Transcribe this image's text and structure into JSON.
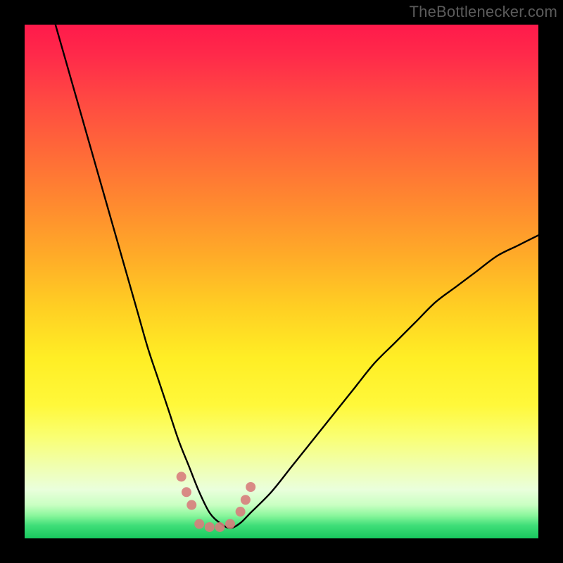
{
  "watermark": "TheBottlenecker.com",
  "colors": {
    "frame": "#000000",
    "curve": "#000000",
    "accent_pink": "#d77d7c",
    "gradient_stops": [
      {
        "offset": 0.0,
        "color": "#ff1a4b"
      },
      {
        "offset": 0.06,
        "color": "#ff2a4a"
      },
      {
        "offset": 0.15,
        "color": "#ff4a42"
      },
      {
        "offset": 0.25,
        "color": "#ff6a38"
      },
      {
        "offset": 0.35,
        "color": "#ff8a2f"
      },
      {
        "offset": 0.45,
        "color": "#ffab28"
      },
      {
        "offset": 0.55,
        "color": "#ffcf23"
      },
      {
        "offset": 0.65,
        "color": "#ffee25"
      },
      {
        "offset": 0.74,
        "color": "#fff83a"
      },
      {
        "offset": 0.8,
        "color": "#faff70"
      },
      {
        "offset": 0.86,
        "color": "#f0ffb0"
      },
      {
        "offset": 0.905,
        "color": "#eaffdc"
      },
      {
        "offset": 0.935,
        "color": "#c9ffc2"
      },
      {
        "offset": 0.955,
        "color": "#8cf79d"
      },
      {
        "offset": 0.975,
        "color": "#3fde78"
      },
      {
        "offset": 1.0,
        "color": "#18c95f"
      }
    ]
  },
  "chart_data": {
    "type": "line",
    "title": "",
    "xlabel": "",
    "ylabel": "",
    "xlim": [
      0,
      100
    ],
    "ylim": [
      0,
      100
    ],
    "grid": false,
    "legend": false,
    "notes": "V-shaped bottleneck curve; minimum (optimal match) around x≈35–40 where y≈2. Background is a vertical heat gradient: red (top, high bottleneck) → yellow → green (bottom, low bottleneck). Small pink marker dots cluster near the valley.",
    "series": [
      {
        "name": "bottleneck-curve",
        "x": [
          6,
          8,
          10,
          12,
          14,
          16,
          18,
          20,
          22,
          24,
          26,
          28,
          30,
          32,
          34,
          36,
          38,
          40,
          42,
          44,
          48,
          52,
          56,
          60,
          64,
          68,
          72,
          76,
          80,
          84,
          88,
          92,
          96,
          100
        ],
        "y": [
          100,
          93,
          86,
          79,
          72,
          65,
          58,
          51,
          44,
          37,
          31,
          25,
          19,
          14,
          9,
          5,
          3,
          2,
          3,
          5,
          9,
          14,
          19,
          24,
          29,
          34,
          38,
          42,
          46,
          49,
          52,
          55,
          57,
          59
        ]
      }
    ],
    "markers": {
      "name": "valley-dots",
      "color": "#d77d7c",
      "points": [
        {
          "x": 30.5,
          "y": 12
        },
        {
          "x": 31.5,
          "y": 9
        },
        {
          "x": 32.5,
          "y": 6.5
        },
        {
          "x": 34.0,
          "y": 2.8
        },
        {
          "x": 36.0,
          "y": 2.2
        },
        {
          "x": 38.0,
          "y": 2.2
        },
        {
          "x": 40.0,
          "y": 2.8
        },
        {
          "x": 42.0,
          "y": 5.2
        },
        {
          "x": 43.0,
          "y": 7.5
        },
        {
          "x": 44.0,
          "y": 10
        }
      ]
    }
  }
}
